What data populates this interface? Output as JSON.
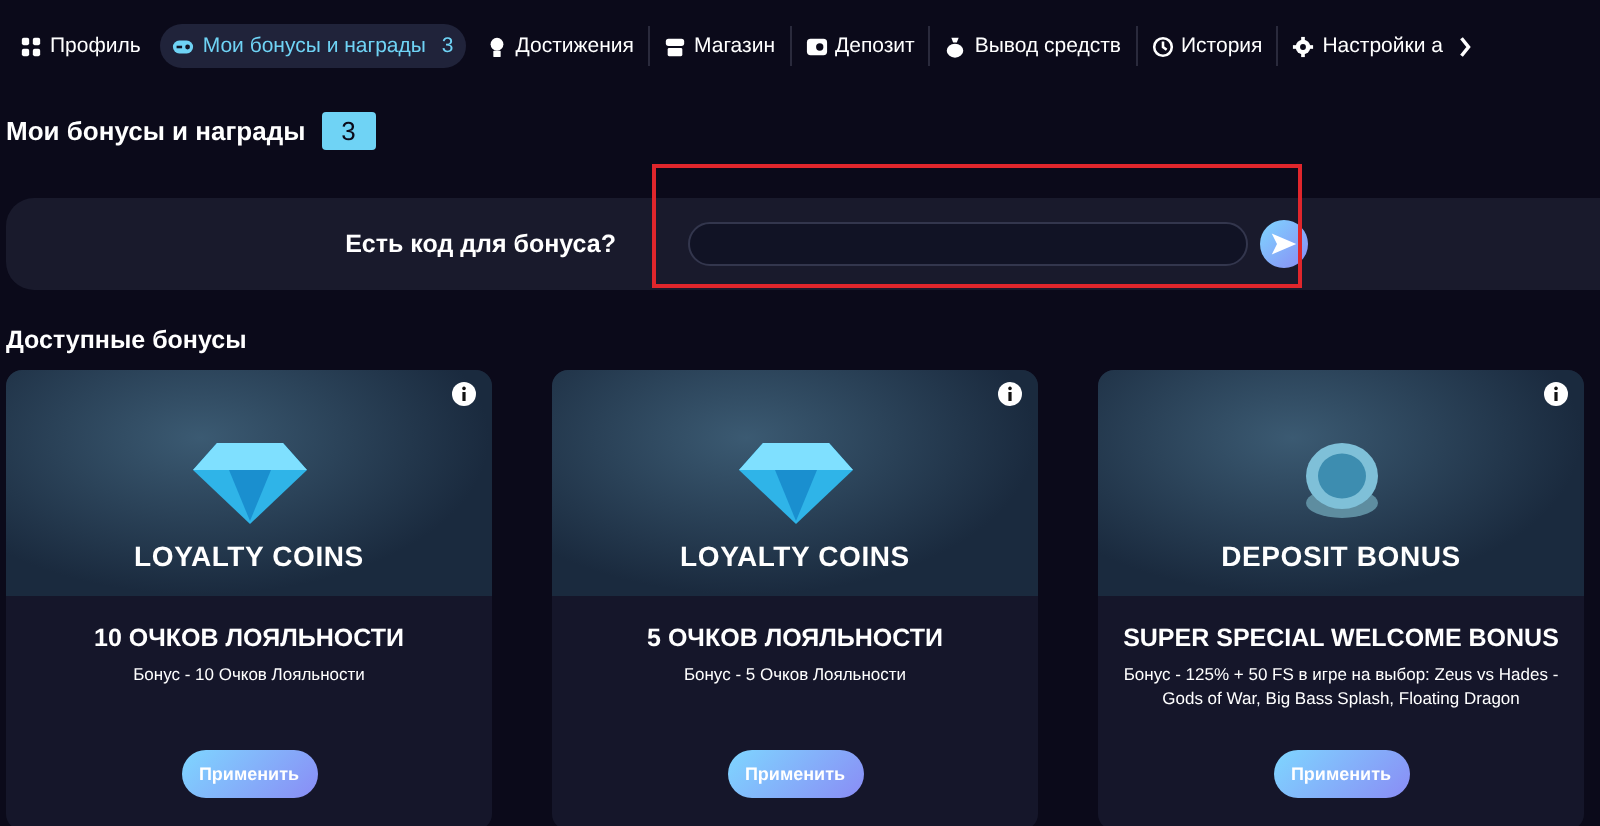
{
  "tabs": [
    {
      "label": "Профиль",
      "selected": false
    },
    {
      "label": "Мои бонусы и награды",
      "count": "3",
      "selected": true
    },
    {
      "label": "Достижения",
      "selected": false
    },
    {
      "label": "Магазин",
      "selected": false
    },
    {
      "label": "Депозит",
      "selected": false
    },
    {
      "label": "Вывод средств",
      "selected": false
    },
    {
      "label": "История",
      "selected": false
    },
    {
      "label": "Настройки а",
      "selected": false
    }
  ],
  "page_title": {
    "text": "Мои бонусы и награды",
    "count": "3"
  },
  "code_bar": {
    "label": "Есть код для бонуса?",
    "highlighted": true
  },
  "section_title": "Доступные бонусы",
  "bonuses": [
    {
      "kind": "gem",
      "banner_label": "LOYALTY COINS",
      "title": "10 ОЧКОВ ЛОЯЛЬНОСТИ",
      "description": "Бонус - 10 Очков Лояльности",
      "button": "Применить"
    },
    {
      "kind": "gem",
      "banner_label": "LOYALTY COINS",
      "title": "5 ОЧКОВ ЛОЯЛЬНОСТИ",
      "description": "Бонус - 5 Очков Лояльности",
      "button": "Применить"
    },
    {
      "kind": "coin",
      "banner_label": "DEPOSIT BONUS",
      "title": "SUPER SPECIAL WELCOME BONUS",
      "description": "Бонус - 125% + 50 FS в игре на выбор: Zeus vs Hades - Gods of War, Big Bass Splash, Floating Dragon",
      "button": "Применить"
    }
  ]
}
